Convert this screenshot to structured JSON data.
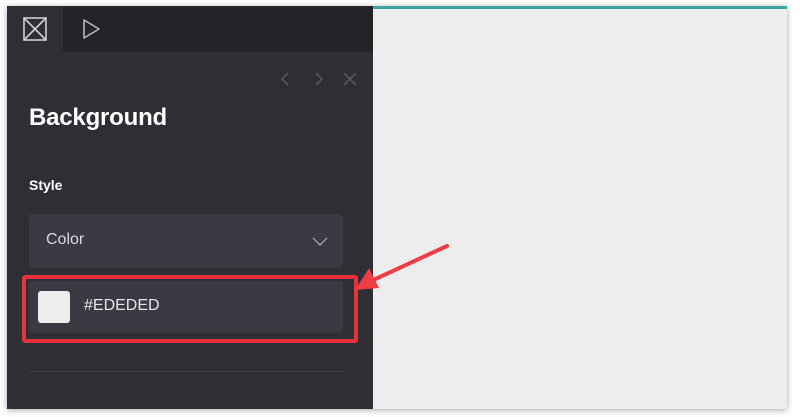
{
  "colors": {
    "accent_bar": "#3aa8a0",
    "swatch": "#EDEDED",
    "highlight": "#e8313a",
    "arrow": "#ee3b46"
  },
  "toolbar": {
    "tabs": [
      {
        "icon": "frame-icon",
        "active": true
      },
      {
        "icon": "play-icon",
        "active": false
      }
    ]
  },
  "panel": {
    "nav_icons": [
      "chevron-left-icon",
      "chevron-right-icon",
      "close-icon"
    ],
    "title": "Background",
    "style_label": "Style",
    "style_select": {
      "value": "Color",
      "icon": "chevron-down-icon"
    },
    "color_field": {
      "value": "#EDEDED"
    }
  }
}
